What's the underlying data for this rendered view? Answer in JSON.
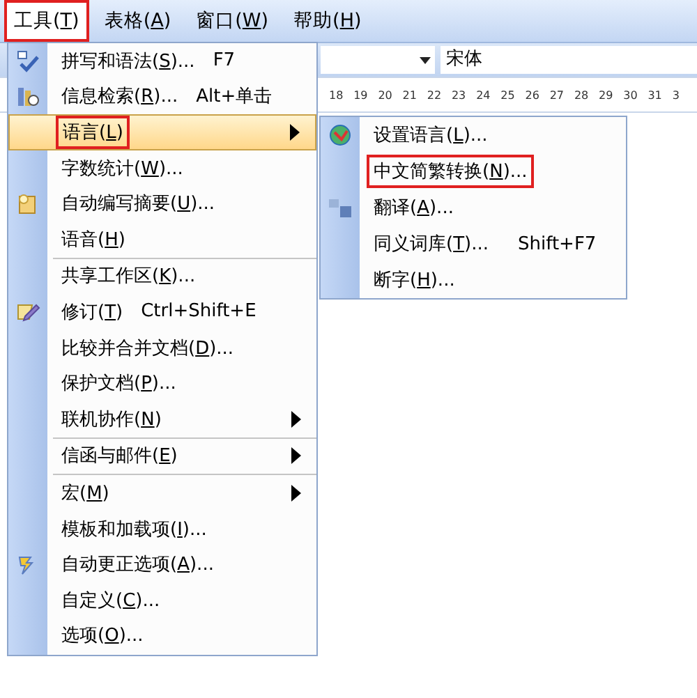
{
  "menubar": [
    {
      "label": "工具(T)",
      "selected": true,
      "highlighted": true
    },
    {
      "label": "表格(A)",
      "selected": false,
      "highlighted": false
    },
    {
      "label": "窗口(W)",
      "selected": false,
      "highlighted": false
    },
    {
      "label": "帮助(H)",
      "selected": false,
      "highlighted": false
    }
  ],
  "toolbar": {
    "font": "宋体"
  },
  "ruler": [
    "18",
    "19",
    "20",
    "21",
    "22",
    "23",
    "24",
    "25",
    "26",
    "27",
    "28",
    "29",
    "30",
    "31",
    "3"
  ],
  "menu": [
    {
      "kind": "item",
      "label": "拼写和语法(S)...",
      "shortcut": "F7",
      "submenu": false,
      "selected": false,
      "highlighted": false
    },
    {
      "kind": "item",
      "label": "信息检索(R)...",
      "shortcut": "Alt+单击",
      "submenu": false,
      "selected": false,
      "highlighted": false
    },
    {
      "kind": "item",
      "label": "语言(L)",
      "submenu": true,
      "selected": true,
      "highlighted": true
    },
    {
      "kind": "item",
      "label": "字数统计(W)...",
      "submenu": false,
      "selected": false,
      "highlighted": false
    },
    {
      "kind": "item",
      "label": "自动编写摘要(U)...",
      "submenu": false,
      "selected": false,
      "highlighted": false
    },
    {
      "kind": "item",
      "label": "语音(H)",
      "submenu": false,
      "selected": false,
      "highlighted": false
    },
    {
      "kind": "separator"
    },
    {
      "kind": "item",
      "label": "共享工作区(K)...",
      "submenu": false,
      "selected": false,
      "highlighted": false
    },
    {
      "kind": "item",
      "label": "修订(T)",
      "shortcut": "Ctrl+Shift+E",
      "submenu": false,
      "selected": false,
      "highlighted": false
    },
    {
      "kind": "item",
      "label": "比较并合并文档(D)...",
      "submenu": false,
      "selected": false,
      "highlighted": false
    },
    {
      "kind": "item",
      "label": "保护文档(P)...",
      "submenu": false,
      "selected": false,
      "highlighted": false
    },
    {
      "kind": "item",
      "label": "联机协作(N)",
      "submenu": true,
      "selected": false,
      "highlighted": false
    },
    {
      "kind": "separator"
    },
    {
      "kind": "item",
      "label": "信函与邮件(E)",
      "submenu": true,
      "selected": false,
      "highlighted": false
    },
    {
      "kind": "separator"
    },
    {
      "kind": "item",
      "label": "宏(M)",
      "submenu": true,
      "selected": false,
      "highlighted": false
    },
    {
      "kind": "item",
      "label": "模板和加载项(I)...",
      "submenu": false,
      "selected": false,
      "highlighted": false
    },
    {
      "kind": "item",
      "label": "自动更正选项(A)...",
      "submenu": false,
      "selected": false,
      "highlighted": false
    },
    {
      "kind": "item",
      "label": "自定义(C)...",
      "submenu": false,
      "selected": false,
      "highlighted": false
    },
    {
      "kind": "item",
      "label": "选项(O)...",
      "submenu": false,
      "selected": false,
      "highlighted": false
    }
  ],
  "submenu": [
    {
      "label": "设置语言(L)...",
      "highlighted": false
    },
    {
      "label": "中文简繁转换(N)...",
      "highlighted": true
    },
    {
      "label": "翻译(A)...",
      "highlighted": false
    },
    {
      "label": "同义词库(T)...",
      "shortcut": "Shift+F7",
      "highlighted": false
    },
    {
      "label": "断字(H)...",
      "highlighted": false
    }
  ]
}
